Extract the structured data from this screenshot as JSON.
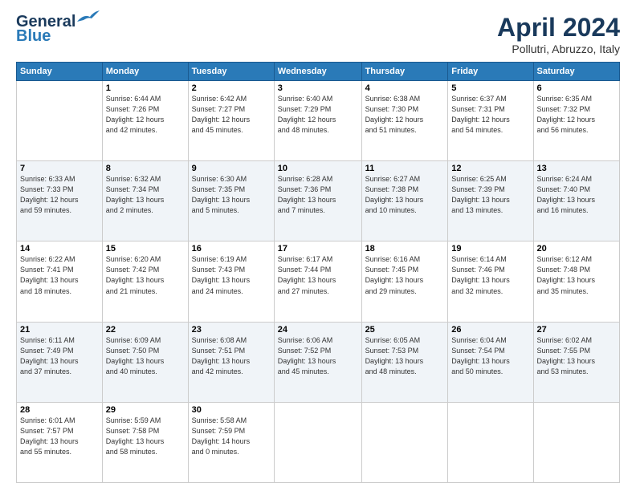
{
  "header": {
    "logo_line1": "General",
    "logo_line2": "Blue",
    "title": "April 2024",
    "subtitle": "Pollutri, Abruzzo, Italy"
  },
  "columns": [
    "Sunday",
    "Monday",
    "Tuesday",
    "Wednesday",
    "Thursday",
    "Friday",
    "Saturday"
  ],
  "weeks": [
    [
      {
        "num": "",
        "info": ""
      },
      {
        "num": "1",
        "info": "Sunrise: 6:44 AM\nSunset: 7:26 PM\nDaylight: 12 hours\nand 42 minutes."
      },
      {
        "num": "2",
        "info": "Sunrise: 6:42 AM\nSunset: 7:27 PM\nDaylight: 12 hours\nand 45 minutes."
      },
      {
        "num": "3",
        "info": "Sunrise: 6:40 AM\nSunset: 7:29 PM\nDaylight: 12 hours\nand 48 minutes."
      },
      {
        "num": "4",
        "info": "Sunrise: 6:38 AM\nSunset: 7:30 PM\nDaylight: 12 hours\nand 51 minutes."
      },
      {
        "num": "5",
        "info": "Sunrise: 6:37 AM\nSunset: 7:31 PM\nDaylight: 12 hours\nand 54 minutes."
      },
      {
        "num": "6",
        "info": "Sunrise: 6:35 AM\nSunset: 7:32 PM\nDaylight: 12 hours\nand 56 minutes."
      }
    ],
    [
      {
        "num": "7",
        "info": "Sunrise: 6:33 AM\nSunset: 7:33 PM\nDaylight: 12 hours\nand 59 minutes."
      },
      {
        "num": "8",
        "info": "Sunrise: 6:32 AM\nSunset: 7:34 PM\nDaylight: 13 hours\nand 2 minutes."
      },
      {
        "num": "9",
        "info": "Sunrise: 6:30 AM\nSunset: 7:35 PM\nDaylight: 13 hours\nand 5 minutes."
      },
      {
        "num": "10",
        "info": "Sunrise: 6:28 AM\nSunset: 7:36 PM\nDaylight: 13 hours\nand 7 minutes."
      },
      {
        "num": "11",
        "info": "Sunrise: 6:27 AM\nSunset: 7:38 PM\nDaylight: 13 hours\nand 10 minutes."
      },
      {
        "num": "12",
        "info": "Sunrise: 6:25 AM\nSunset: 7:39 PM\nDaylight: 13 hours\nand 13 minutes."
      },
      {
        "num": "13",
        "info": "Sunrise: 6:24 AM\nSunset: 7:40 PM\nDaylight: 13 hours\nand 16 minutes."
      }
    ],
    [
      {
        "num": "14",
        "info": "Sunrise: 6:22 AM\nSunset: 7:41 PM\nDaylight: 13 hours\nand 18 minutes."
      },
      {
        "num": "15",
        "info": "Sunrise: 6:20 AM\nSunset: 7:42 PM\nDaylight: 13 hours\nand 21 minutes."
      },
      {
        "num": "16",
        "info": "Sunrise: 6:19 AM\nSunset: 7:43 PM\nDaylight: 13 hours\nand 24 minutes."
      },
      {
        "num": "17",
        "info": "Sunrise: 6:17 AM\nSunset: 7:44 PM\nDaylight: 13 hours\nand 27 minutes."
      },
      {
        "num": "18",
        "info": "Sunrise: 6:16 AM\nSunset: 7:45 PM\nDaylight: 13 hours\nand 29 minutes."
      },
      {
        "num": "19",
        "info": "Sunrise: 6:14 AM\nSunset: 7:46 PM\nDaylight: 13 hours\nand 32 minutes."
      },
      {
        "num": "20",
        "info": "Sunrise: 6:12 AM\nSunset: 7:48 PM\nDaylight: 13 hours\nand 35 minutes."
      }
    ],
    [
      {
        "num": "21",
        "info": "Sunrise: 6:11 AM\nSunset: 7:49 PM\nDaylight: 13 hours\nand 37 minutes."
      },
      {
        "num": "22",
        "info": "Sunrise: 6:09 AM\nSunset: 7:50 PM\nDaylight: 13 hours\nand 40 minutes."
      },
      {
        "num": "23",
        "info": "Sunrise: 6:08 AM\nSunset: 7:51 PM\nDaylight: 13 hours\nand 42 minutes."
      },
      {
        "num": "24",
        "info": "Sunrise: 6:06 AM\nSunset: 7:52 PM\nDaylight: 13 hours\nand 45 minutes."
      },
      {
        "num": "25",
        "info": "Sunrise: 6:05 AM\nSunset: 7:53 PM\nDaylight: 13 hours\nand 48 minutes."
      },
      {
        "num": "26",
        "info": "Sunrise: 6:04 AM\nSunset: 7:54 PM\nDaylight: 13 hours\nand 50 minutes."
      },
      {
        "num": "27",
        "info": "Sunrise: 6:02 AM\nSunset: 7:55 PM\nDaylight: 13 hours\nand 53 minutes."
      }
    ],
    [
      {
        "num": "28",
        "info": "Sunrise: 6:01 AM\nSunset: 7:57 PM\nDaylight: 13 hours\nand 55 minutes."
      },
      {
        "num": "29",
        "info": "Sunrise: 5:59 AM\nSunset: 7:58 PM\nDaylight: 13 hours\nand 58 minutes."
      },
      {
        "num": "30",
        "info": "Sunrise: 5:58 AM\nSunset: 7:59 PM\nDaylight: 14 hours\nand 0 minutes."
      },
      {
        "num": "",
        "info": ""
      },
      {
        "num": "",
        "info": ""
      },
      {
        "num": "",
        "info": ""
      },
      {
        "num": "",
        "info": ""
      }
    ]
  ]
}
